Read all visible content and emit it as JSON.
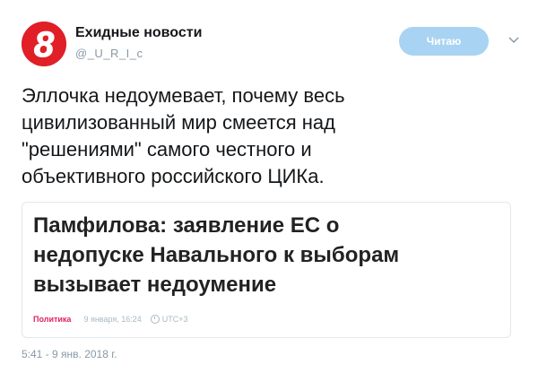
{
  "author": {
    "name": "Ехидные новости",
    "handle": "@_U_R_I_c",
    "avatar_icon": "red-circle-number-8-logo",
    "avatar_color": "#e01f26"
  },
  "follow_button": {
    "label": "Читаю",
    "color": "#a9d3f2"
  },
  "tweet_text": "Эллочка недоумевает, почему весь\nцивилизованный мир смеется над\n\"решениями\" самого честного и\nобъективного российского ЦИКа.",
  "card": {
    "headline": "Памфилова: заявление ЕС о\nнедопуске Навального к выборам\nвызывает недоумение",
    "category": "Политика",
    "date": "9 января, 16:24",
    "timezone": "UTC+3",
    "category_color": "#e0245e"
  },
  "timestamp": "5:41 - 9 янв. 2018 г."
}
